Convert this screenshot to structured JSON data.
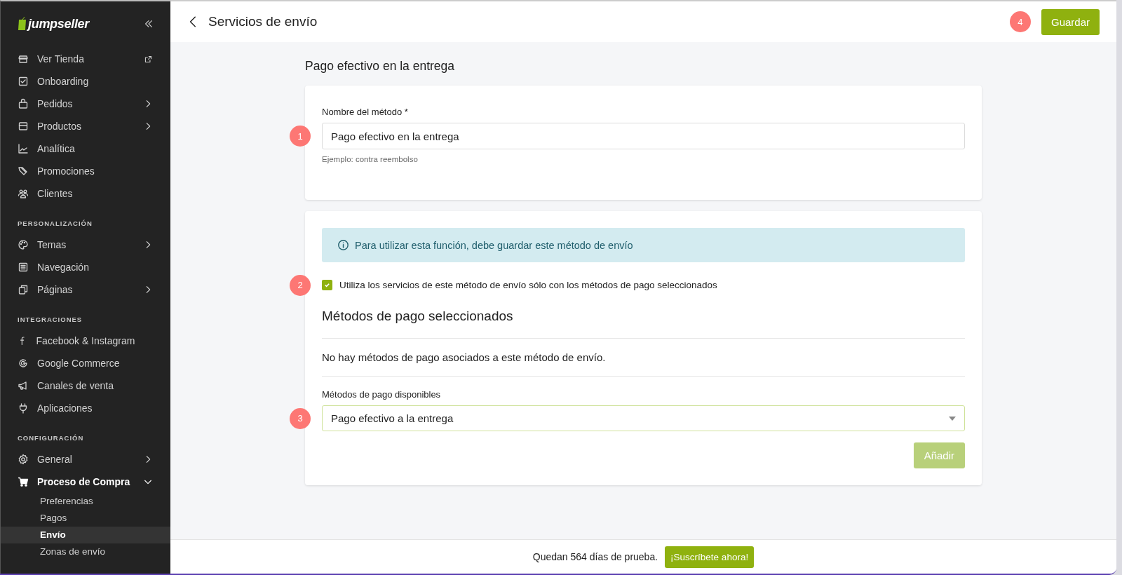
{
  "sidebar": {
    "logo": "jumpseller",
    "sections": [
      {
        "items": [
          {
            "label": "Ver Tienda",
            "kind": "external",
            "selected": false
          },
          {
            "label": "Onboarding",
            "kind": "link",
            "selected": false
          },
          {
            "label": "Pedidos",
            "kind": "submenu",
            "expanded": false,
            "selected": false
          },
          {
            "label": "Productos",
            "kind": "submenu",
            "expanded": false,
            "selected": false
          },
          {
            "label": "Analítica",
            "kind": "link",
            "selected": false
          },
          {
            "label": "Promociones",
            "kind": "link",
            "selected": false
          },
          {
            "label": "Clientes",
            "kind": "link",
            "selected": false
          }
        ]
      },
      {
        "heading": "PERSONALIZACIÓN",
        "items": [
          {
            "label": "Temas",
            "kind": "submenu",
            "expanded": false,
            "selected": false
          },
          {
            "label": "Navegación",
            "kind": "link",
            "selected": false
          },
          {
            "label": "Páginas",
            "kind": "submenu",
            "expanded": false,
            "selected": false
          }
        ]
      },
      {
        "heading": "INTEGRACIONES",
        "items": [
          {
            "label": "Facebook & Instagram",
            "kind": "link",
            "selected": false
          },
          {
            "label": "Google Commerce",
            "kind": "link",
            "selected": false
          },
          {
            "label": "Canales de venta",
            "kind": "link",
            "selected": false
          },
          {
            "label": "Aplicaciones",
            "kind": "link",
            "selected": false
          }
        ]
      },
      {
        "heading": "CONFIGURACIÓN",
        "items": [
          {
            "label": "General",
            "kind": "submenu",
            "expanded": false,
            "selected": false
          },
          {
            "label": "Proceso de Compra",
            "kind": "submenu",
            "expanded": true,
            "selected": true,
            "children": [
              {
                "label": "Preferencias",
                "selected": false
              },
              {
                "label": "Pagos",
                "selected": false
              },
              {
                "label": "Envío",
                "selected": true
              },
              {
                "label": "Zonas de envío",
                "selected": false
              }
            ]
          }
        ]
      }
    ]
  },
  "header": {
    "title": "Servicios de envío",
    "save_button": "Guardar",
    "marker": "4"
  },
  "section_title": "Pago efectivo en la entrega",
  "name_card": {
    "label": "Nombre del método *",
    "value": "Pago efectivo en la entrega",
    "help": "Ejemplo: contra reembolso",
    "marker": "1"
  },
  "payment_card": {
    "alert": "Para utilizar esta función, debe guardar este método de envío",
    "restrict_checkbox": {
      "label": "Utiliza los servicios de este método de envío sólo con los métodos de pago seleccionados",
      "checked": true,
      "marker": "2"
    },
    "selected_heading": "Métodos de pago seleccionados",
    "empty_text": "No hay métodos de pago asociados a este método de envío.",
    "available_label": "Métodos de pago disponibles",
    "available_select": {
      "value": "Pago efectivo a la entrega",
      "marker": "3"
    },
    "add_button": {
      "label": "Añadir",
      "disabled": true
    }
  },
  "footer": {
    "text": "Quedan 564 días de prueba.",
    "button": "¡Suscríbete ahora!"
  }
}
